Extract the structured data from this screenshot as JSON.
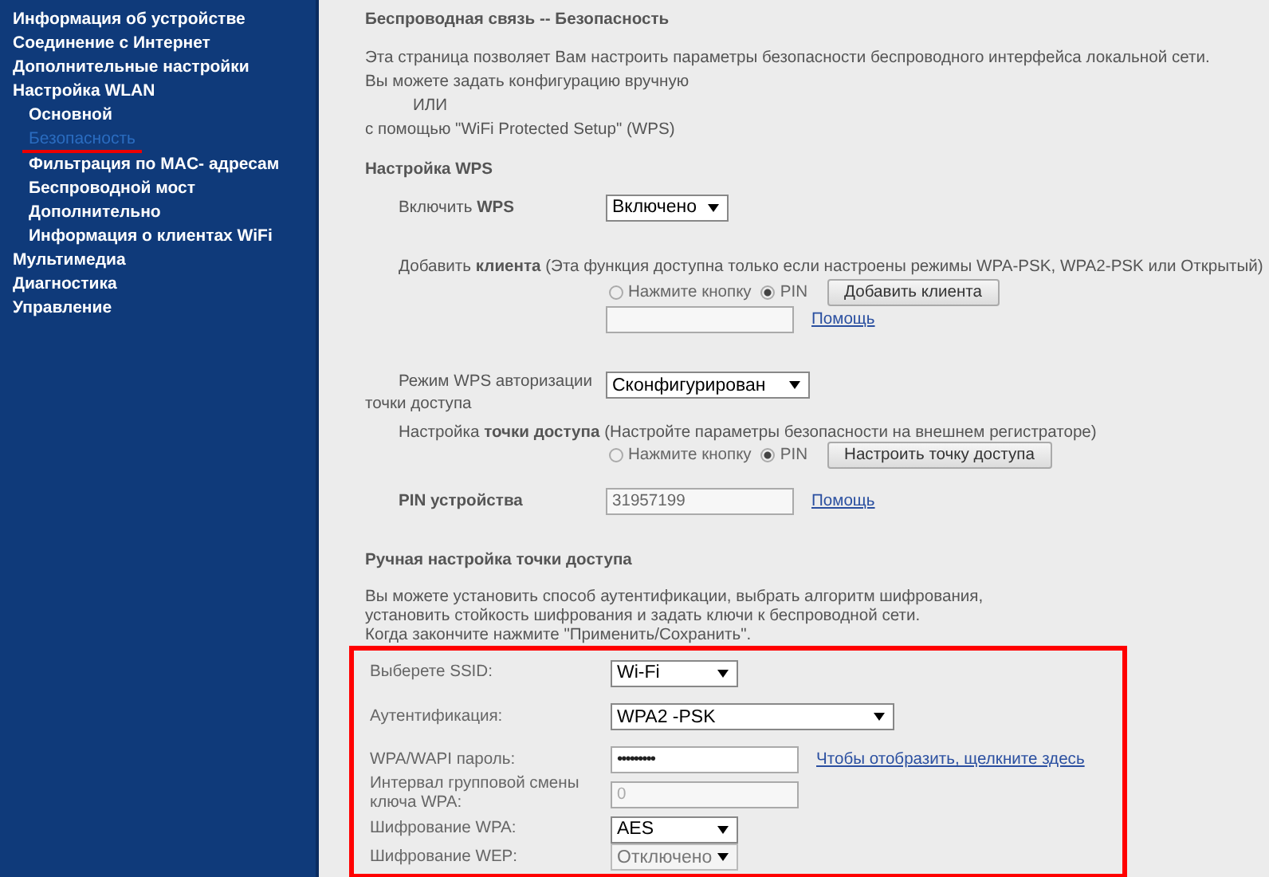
{
  "sidebar": {
    "items": [
      {
        "label": "Информация об устройстве",
        "selected": false,
        "highlighted": false
      },
      {
        "label": "Соединение с Интернет",
        "selected": false,
        "highlighted": false
      },
      {
        "label": "Дополнительные настройки",
        "selected": false,
        "highlighted": false
      },
      {
        "label": "Настройка WLAN",
        "selected": false,
        "highlighted": false,
        "children": [
          {
            "label": "Основной",
            "selected": false,
            "highlighted": false
          },
          {
            "label": "Безопасность",
            "selected": true,
            "highlighted": true
          },
          {
            "label": "Фильтрация по MAC- адресам",
            "selected": false,
            "highlighted": false
          },
          {
            "label": "Беспроводной мост",
            "selected": false,
            "highlighted": false
          },
          {
            "label": "Дополнительно",
            "selected": false,
            "highlighted": false
          },
          {
            "label": "Информация о клиентах WiFi",
            "selected": false,
            "highlighted": false
          }
        ]
      },
      {
        "label": "Мультимедиа",
        "selected": false,
        "highlighted": false
      },
      {
        "label": "Диагностика",
        "selected": false,
        "highlighted": false
      },
      {
        "label": "Управление",
        "selected": false,
        "highlighted": false
      }
    ]
  },
  "page": {
    "title": "Беспроводная связь -- Безопасность",
    "intro": [
      {
        "text": "Эта страница позволяет Вам настроить параметры безопасности беспроводного интерфейса локальной сети.",
        "indented": false
      },
      {
        "text": "Вы можете задать конфигурацию вручную",
        "indented": false
      },
      {
        "text": "ИЛИ",
        "indented": true
      },
      {
        "text": "с помощью \"WiFi Protected Setup\" (WPS)",
        "indented": false
      }
    ]
  },
  "wps": {
    "heading": "Настройка WPS",
    "enable": {
      "label": "Включить **WPS**",
      "value": "Включено"
    },
    "add_client": {
      "label": "Добавить **клиента** (Эта функция доступна только если настроены режимы WPA-PSK, WPA2-PSK или Открытый)",
      "radios": [
        {
          "label": "Нажмите кнопку",
          "selected": false
        },
        {
          "label": "PIN",
          "selected": true
        }
      ],
      "button": "Добавить клиента",
      "help_link": "Помощь"
    },
    "mode": {
      "label": "Режим WPS авторизации точки доступа",
      "value": "Сконфигурирован"
    },
    "ap_config": {
      "label": "Настройка **точки доступа** (Настройте параметры безопасности на внешнем регистраторе)",
      "radios": [
        {
          "label": "Нажмите кнопку",
          "selected": false
        },
        {
          "label": "PIN",
          "selected": true
        }
      ],
      "button": "Настроить точку доступа"
    },
    "device_pin": {
      "label": "PIN устройства",
      "value": "31957199",
      "help_link": "Помощь"
    }
  },
  "manual": {
    "heading": "Ручная настройка точки доступа",
    "description": [
      "Вы можете установить способ аутентификации, выбрать алгоритм шифрования,",
      "установить стойкость шифрования и задать ключи к беспроводной сети.",
      "Когда закончите нажмите \"Применить/Сохранить\"."
    ],
    "highlighted": true,
    "fields": [
      {
        "kind": "select",
        "label": "Выберете SSID:",
        "value": "Wi-Fi",
        "disabled": false
      },
      {
        "kind": "wide_select",
        "label": "Аутентификация:",
        "value": "WPA2 -PSK",
        "disabled": false
      },
      {
        "kind": "password",
        "label": "WPA/WAPI пароль:",
        "value": "•••••••••",
        "link": "Чтобы отобразить, щелкните здесь",
        "disabled": false
      },
      {
        "kind": "text",
        "label": "Интервал групповой смены ключа WPA:",
        "value": "0",
        "disabled": true
      },
      {
        "kind": "select",
        "label": "Шифрование WPA:",
        "value": "AES",
        "disabled": false
      },
      {
        "kind": "select",
        "label": "Шифрование WEP:",
        "value": "Отключено",
        "disabled": true
      }
    ]
  }
}
